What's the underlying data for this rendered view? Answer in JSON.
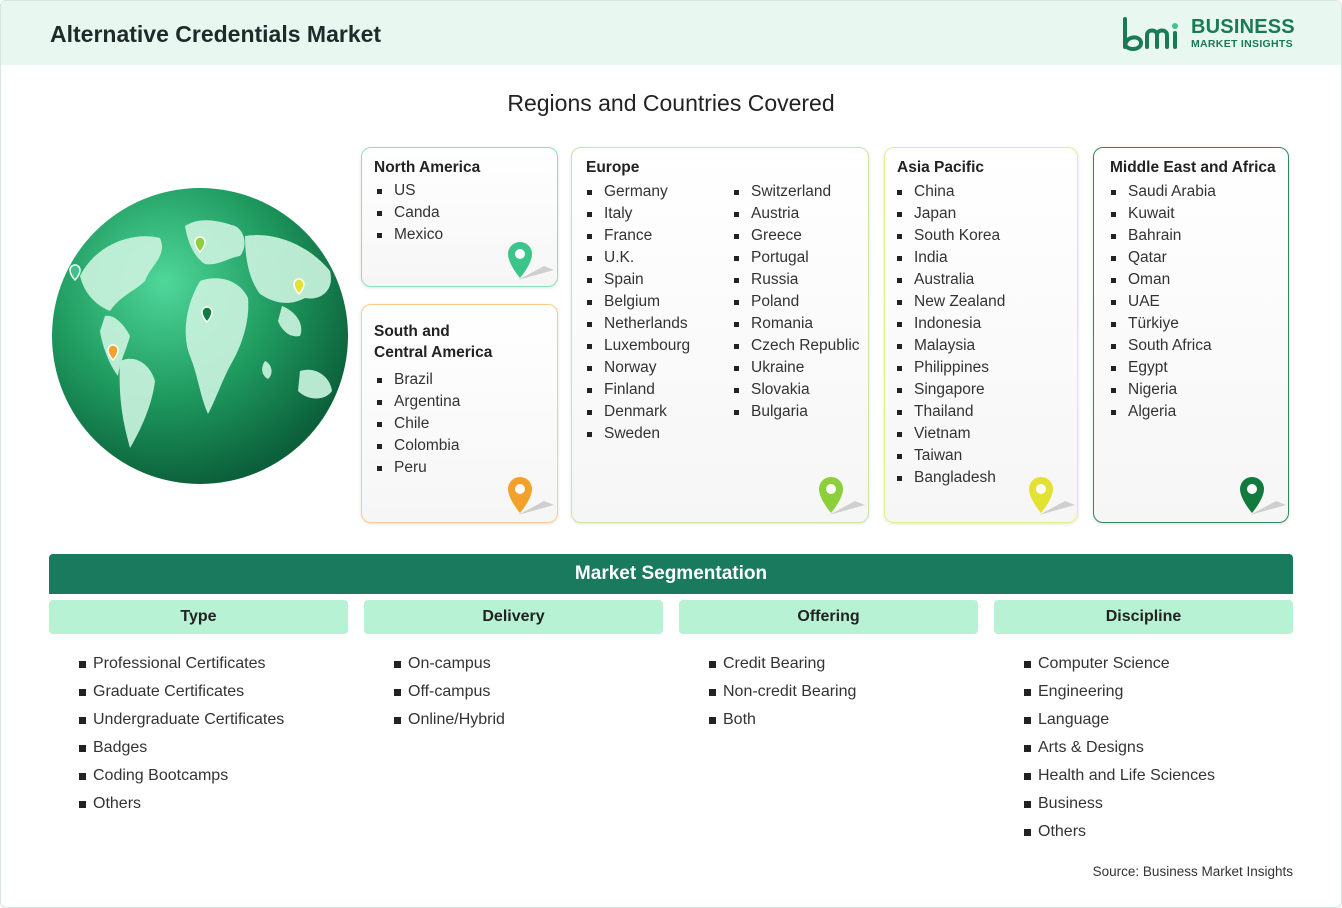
{
  "header": {
    "title": "Alternative Credentials Market",
    "logo_line1": "BUSINESS",
    "logo_line2": "MARKET INSIGHTS",
    "logo_mark": "bmi"
  },
  "regions_title": "Regions and Countries Covered",
  "regions": {
    "north_america": {
      "title": "North America",
      "countries": [
        "US",
        "Canda",
        "Mexico"
      ],
      "pin_color": "#3cc48a"
    },
    "south_central_america": {
      "title_line1": "South and",
      "title_line2": "Central America",
      "countries": [
        "Brazil",
        "Argentina",
        "Chile",
        "Colombia",
        "Peru"
      ],
      "pin_color": "#f2a12b"
    },
    "europe": {
      "title": "Europe",
      "countries_col1": [
        "Germany",
        "Italy",
        "France",
        "U.K.",
        "Spain",
        "Belgium",
        "Netherlands",
        "Luxembourg",
        "Norway",
        "Finland",
        "Denmark",
        "Sweden"
      ],
      "countries_col2": [
        "Switzerland",
        "Austria",
        "Greece",
        "Portugal",
        "Russia",
        "Poland",
        "Romania",
        "Czech Republic",
        "Ukraine",
        "Slovakia",
        "Bulgaria"
      ],
      "pin_color": "#8bcf3a"
    },
    "asia_pacific": {
      "title": "Asia Pacific",
      "countries": [
        "China",
        "Japan",
        "South Korea",
        "India",
        "Australia",
        "New Zealand",
        "Indonesia",
        "Malaysia",
        "Philippines",
        "Singapore",
        "Thailand",
        "Vietnam",
        "Taiwan",
        "Bangladesh"
      ],
      "pin_color": "#e3e234"
    },
    "middle_east_africa": {
      "title": "Middle East and Africa",
      "countries": [
        "Saudi Arabia",
        "Kuwait",
        "Bahrain",
        "Qatar",
        "Oman",
        "UAE",
        "Türkiye",
        "South Africa",
        "Egypt",
        "Nigeria",
        "Algeria"
      ],
      "pin_color": "#137a3e"
    }
  },
  "segmentation": {
    "title": "Market Segmentation",
    "columns": [
      {
        "heading": "Type",
        "items": [
          "Professional Certificates",
          "Graduate Certificates",
          "Undergraduate Certificates",
          "Badges",
          "Coding Bootcamps",
          "Others"
        ]
      },
      {
        "heading": "Delivery",
        "items": [
          "On-campus",
          "Off-campus",
          "Online/Hybrid"
        ]
      },
      {
        "heading": "Offering",
        "items": [
          "Credit Bearing",
          "Non-credit Bearing",
          "Both"
        ]
      },
      {
        "heading": "Discipline",
        "items": [
          "Computer Science",
          "Engineering",
          "Language",
          "Arts & Designs",
          "Health and Life Sciences",
          "Business",
          "Others"
        ]
      }
    ]
  },
  "source": "Source: Business Market Insights",
  "colors": {
    "header_bg": "#e8f7ef",
    "brand_green": "#1a7a55",
    "segmentation_bar": "#1a7a5e",
    "segment_head_bg": "#b8f2d4"
  }
}
